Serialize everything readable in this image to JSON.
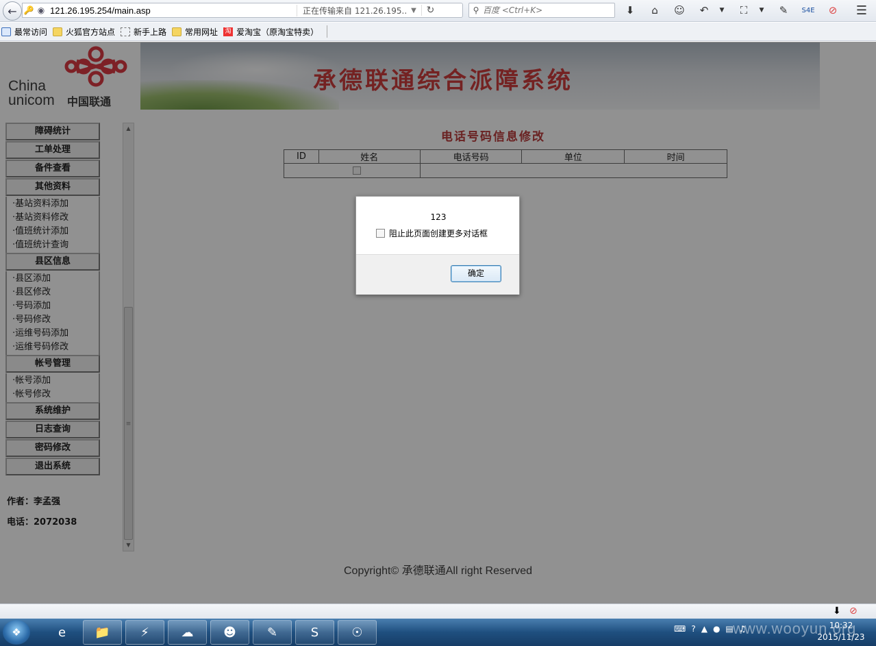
{
  "browser": {
    "url": "121.26.195.254/main.asp",
    "url_status": "正在传输来自 121.26.195....",
    "search_placeholder": "百度 <Ctrl+K>"
  },
  "bookmarks": [
    "最常访问",
    "火狐官方站点",
    "新手上路",
    "常用网址",
    "爱淘宝（原淘宝特卖）"
  ],
  "banner": {
    "logo_en_1": "China",
    "logo_en_2": "unicom",
    "logo_cn": "中国联通",
    "title": "承德联通综合派障系统"
  },
  "menu": {
    "sections": [
      {
        "label": "障碍统计"
      },
      {
        "label": "工单处理"
      },
      {
        "label": "备件查看"
      },
      {
        "label": "其他资料",
        "items": [
          "基站资料添加",
          "基站资料修改",
          "值班统计添加",
          "值班统计查询"
        ]
      },
      {
        "label": "县区信息",
        "items": [
          "县区添加",
          "县区修改",
          "号码添加",
          "号码修改",
          "运维号码添加",
          "运维号码修改"
        ]
      },
      {
        "label": "帐号管理",
        "items": [
          "帐号添加",
          "帐号修改"
        ]
      },
      {
        "label": "系统维护"
      },
      {
        "label": "日志查询"
      },
      {
        "label": "密码修改"
      },
      {
        "label": "退出系统"
      }
    ],
    "author": "作者：李孟强",
    "phone": "电话：2072038"
  },
  "main": {
    "title": "电话号码信息修改",
    "columns": [
      "ID",
      "姓名",
      "电话号码",
      "单位",
      "时间"
    ]
  },
  "footer": "Copyright© 承德联通All right Reserved",
  "dialog": {
    "message": "123",
    "checkbox_label": "阻止此页面创建更多对话框",
    "ok_label": "确定"
  },
  "taskbar": {
    "time": "10:32",
    "date": "2015/11/23"
  },
  "watermark": "www.wooyun.org"
}
